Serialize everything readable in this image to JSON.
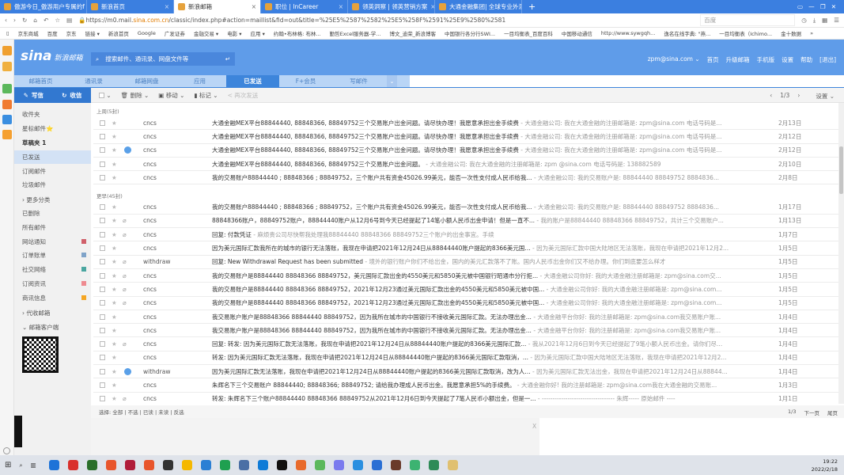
{
  "browser": {
    "tabs": [
      {
        "label": "傲游今日_傲游用户专属的f"
      },
      {
        "label": "新浪首页"
      },
      {
        "label": "新浪邮箱",
        "active": true
      },
      {
        "label": "职位 | InCareer"
      },
      {
        "label": "领英洞察 | 领英营销方案"
      },
      {
        "label": "大通金融集团| 全球专业外汇"
      }
    ],
    "url_prefix": "https://m0.mail.",
    "url_host": "sina.com.cn",
    "url_rest": "/classic/index.php#action=maillist&fid=out&title=%25E5%2587%2582%25E5%258F%2591%25E9%2580%2581",
    "search_engine": "百度",
    "bookmarks": [
      "京东商城",
      "百度",
      "京东",
      "链接 ▾",
      "新浪首页",
      "Google",
      "广发证券",
      "金融交易 ▾",
      "电影 ▾",
      "应用 ▾",
      "约翰•布林格: 布林...",
      "勤哲Excel服务器-学...",
      "博文_迪荣_新浪博客",
      "中国银行各分行SWI...",
      "一目均衡表_百度百科",
      "中国移动通信",
      "http://www.sywgqh...",
      "逸名在线字典: \"燕...",
      "一目均衡表（Ichimo...",
      "金十数据",
      "»"
    ]
  },
  "header": {
    "logo": "sina",
    "logo_sub": "新浪邮箱",
    "search_placeholder": "搜索邮件、通讯录、网盘文件等",
    "user": "zpm@sina.com ⌄",
    "links": [
      "首页",
      "升级邮箱",
      "手机版",
      "设置",
      "帮助",
      "[退出]"
    ]
  },
  "nav": {
    "tabs": [
      "邮箱首页",
      "通讯录",
      "邮箱网盘",
      "应用",
      "已发送",
      "F+会员",
      "写邮件"
    ],
    "active": 4
  },
  "toolbar": {
    "compose": "写信",
    "receive": "收信",
    "delete": "删除 ⌄",
    "move": "移动 ⌄",
    "mark": "标记 ⌄",
    "resend": "< 再次发送",
    "page": "1/3",
    "settings": "设置 ⌄"
  },
  "sidebar": {
    "folders": [
      "收件夹",
      "星标邮件⭐",
      "草稿夹 1",
      "已发送",
      "订阅邮件",
      "垃圾邮件",
      "› 更多分类",
      "已删除",
      "所有邮件",
      "网站通知",
      "订单账单",
      "社交网络",
      "订阅资讯",
      "商讯信息",
      "› 代收邮箱",
      "⌄ 邮箱客户端"
    ],
    "tag_colors": {
      "网站通知": "#d0606a",
      "订单账单": "#7fa3c9",
      "社交网络": "#4aa6a0",
      "订阅资讯": "#ee8a90",
      "商讯信息": "#f5a623"
    }
  },
  "list": {
    "groups": [
      {
        "label": "上周(5封)",
        "rows": [
          {
            "sender": "cncs",
            "subject": "大通金融MEX平台88844440, 88848366, 88849752三个交易账户出金问题。请尽快办理！我愿意承担出金手续费",
            "preview": " - 大通金融公司:  我在大通金融的注册邮箱是: zpm@sina.com 电话号码是...",
            "date": "2月13日"
          },
          {
            "sender": "cncs",
            "subject": "大通金融MEX平台88844440, 88848366, 88849752三个交易账户出金问题。请尽快办理！我愿意承担出金手续费",
            "preview": " - 大通金融公司:  我在大通金融的注册邮箱是: zpm@sina.com 电话号码是...",
            "date": "2月12日"
          },
          {
            "sender": "cncs",
            "icon": true,
            "subject": "大通金融MEX平台88844440, 88848366, 88849752三个交易账户出金问题。请尽快办理！我愿意承担出金手续费",
            "preview": " - 大通金融公司:  我在大通金融的注册邮箱是: zpm@sina.com 电话号码是...",
            "date": "2月12日"
          },
          {
            "sender": "cncs",
            "subject": "大通金融MEX平台88844440, 88848366, 88849752三个交易账户出金问题。",
            "preview": " - 大通金融公司:  我在大通金融的注册邮箱是: zpm @sina.com 电话号码是: 138882589",
            "date": "2月10日"
          },
          {
            "sender": "cncs",
            "subject": "我的交易账户88844440 ; 88848366 ; 88849752，三个账户共有资金45026.99美元，能否一次性支付成人民币给我...",
            "preview": " - 大通金融公司: 我的交易账户是: 88844440 88849752 8884836...",
            "date": "2月8日"
          }
        ]
      },
      {
        "label": "更早(45封)",
        "rows": [
          {
            "sender": "cncs",
            "subject": "我的交易账户88844440 ; 88848366 ; 88849752，三个账户共有资金45026.99美元，能否一次性支付成人民币给我...",
            "preview": " - 大通金融公司: 我的交易账户是: 88844440 88849752 8884836...",
            "date": "1月17日"
          },
          {
            "sender": "cncs",
            "attach": true,
            "subject": "88848366账户，88849752账户，88844440账户从12月6号到今天已经提起了14笔小额人民币出金申请！但是一直不...",
            "preview": " - 我的账户是88844440 88848366 88849752，共计三个交易账户...",
            "date": "1月13日"
          },
          {
            "sender": "cncs",
            "attach": true,
            "subject": "回复: 付款凭证",
            "preview": " - 麻烦贵公司尽快帮我处理我88844440 88848366 88849752三个账户的出金事宜。手续",
            "date": "1月7日"
          },
          {
            "sender": "cncs",
            "subject": "因为美元国际汇款我所在的城市的银行无法落账，我现在申请把2021年12月24日从88844440账户提起的8366美元国...",
            "preview": " - 因为美元国际汇款中国大陆地区无法落账，我现在申请把2021年12月2...",
            "date": "1月5日"
          },
          {
            "sender": "withdraw",
            "attach": true,
            "subject": "回复: New Withdrawal Request has been submitted",
            "preview": " - 境外的银行账户你们不给出金，国内的美元汇款落不了账。国内人民币出金你们又不给办理。你们到底要怎么样才",
            "date": "1月5日"
          },
          {
            "sender": "cncs",
            "attach": true,
            "subject": "我的交易账户是88844440 88848366 88849752，美元国际汇款出金的4550美元和5850美元被中国银行昭通市分行拒...",
            "preview": " - 大通金融公司你好: 我的大通金融注册邮箱是: zpm@sina.com交...",
            "date": "1月5日"
          },
          {
            "sender": "cncs",
            "attach": true,
            "subject": "我的交易账户是88844440 88848366 88849752，2021年12月23通过美元国际汇款出金的4550美元和5850美元被中国...",
            "preview": " - 大通金融公司你好: 我的大通金融注册邮箱是: zpm@sina.com...",
            "date": "1月5日"
          },
          {
            "sender": "cncs",
            "attach": true,
            "subject": "我的交易账户是88844440 88848366 88849752，2021年12月23通过美元国际汇款出金的4550美元和5850美元被中国...",
            "preview": " - 大通金融公司你好: 我的大通金融注册邮箱是: zpm@sina.com...",
            "date": "1月5日"
          },
          {
            "sender": "cncs",
            "subject": "我交易账户账户是88848366 88844440 88849752，因为我所在城市的中国银行不接收美元国际汇款。无法办理出金...",
            "preview": " - 大通金融平台你好: 我的注册邮箱是: zpm@sina.com我交易账户账...",
            "date": "1月4日"
          },
          {
            "sender": "cncs",
            "subject": "我交易账户账户是88848366 88844440 88849752，因为我所在城市的中国银行不接收美元国际汇款。无法办理出金...",
            "preview": " - 大通金融平台你好: 我的注册邮箱是: zpm@sina.com我交易账户账...",
            "date": "1月4日"
          },
          {
            "sender": "cncs",
            "attach": true,
            "subject": "回复: 转发: 因为美元国际汇款无法落账，我现在申请把2021年12月24日从88844440账户提起的8366美元国际汇款...",
            "preview": " - 我从2021年12月6日到今天已经提起了9笔小额人民币出金。请你们尽...",
            "date": "1月4日"
          },
          {
            "sender": "cncs",
            "subject": "转发: 因为美元国际汇款无法落账，我现在申请把2021年12月24日从88844440账户提起的8366美元国际汇款取消，...",
            "preview": " - 因为美元国际汇款中国大陆地区无法落账，我现在申请把2021年12月2...",
            "date": "1月4日"
          },
          {
            "sender": "withdraw",
            "icon": true,
            "subject": "因为美元国际汇款无法落账，我现在申请把2021年12月24日从88844440账户提起的8366美元国际汇款取消，改为人...",
            "preview": " - 因为美元国际汇款无法出金，我现在申请把2021年12月24日从88844...",
            "date": "1月4日"
          },
          {
            "sender": "cncs",
            "subject": "朱辉名下三个交易账户 88844440; 88848366; 88849752; 请给我办理成人民币出金。我愿意承担5%的手续费。",
            "preview": " - 大通金融你好! 我的注册邮箱是: zpm@sina.com我在大通金融的交易账...",
            "date": "1月3日"
          },
          {
            "sender": "cncs",
            "attach": true,
            "subject": "转发: 朱辉名下三个账户88844440 88848366 88849752从2021年12月6日到今天提起了7笔人民币小额出金，但是一...",
            "preview": " - ---------------------------------- 朱辉----- 原始邮件 ----",
            "date": "1月1日"
          }
        ]
      }
    ]
  },
  "footer": {
    "select_label": "选择:",
    "select_options": "全部 | 不选 | 已读 | 未读 | 反选",
    "page": "1/3",
    "next": "下一页",
    "last": "尾页",
    "close": "X"
  },
  "taskbar": {
    "time": "19:22",
    "date": "2022/2/18"
  }
}
